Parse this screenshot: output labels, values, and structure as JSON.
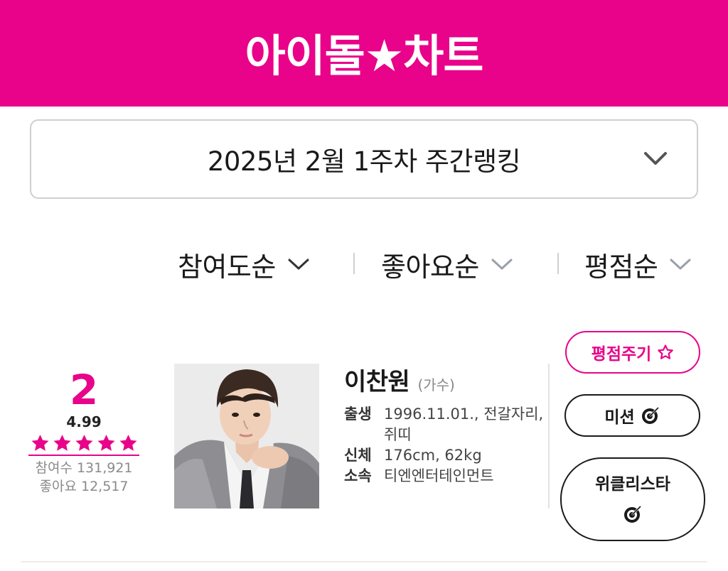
{
  "header": {
    "logo_text": "아이돌★차트",
    "bg_color": "#e8038a"
  },
  "week_selector": {
    "label": "2025년 2월 1주차 주간랭킹",
    "icon": "chevron-down-icon"
  },
  "sort": {
    "options": [
      {
        "label": "참여도순",
        "active": true
      },
      {
        "label": "좋아요순",
        "active": false
      },
      {
        "label": "평점순",
        "active": false
      }
    ]
  },
  "entry": {
    "rank": "2",
    "score": "4.99",
    "stars": 5,
    "participants": "참여수 131,921",
    "likes": "좋아요 12,517",
    "name": "이찬원",
    "role": "(가수)",
    "details": [
      {
        "key": "출생",
        "value": "1996.11.01., 전갈자리, 쥐띠"
      },
      {
        "key": "신체",
        "value": "176cm, 62kg"
      },
      {
        "key": "소속",
        "value": "티엔엔터테인먼트"
      }
    ]
  },
  "actions": {
    "rate": "평점주기",
    "mission": "미션",
    "weekly": "위클리스타"
  },
  "colors": {
    "accent": "#e8038a",
    "text": "#1a1a1a",
    "muted": "#8a8a8a"
  }
}
